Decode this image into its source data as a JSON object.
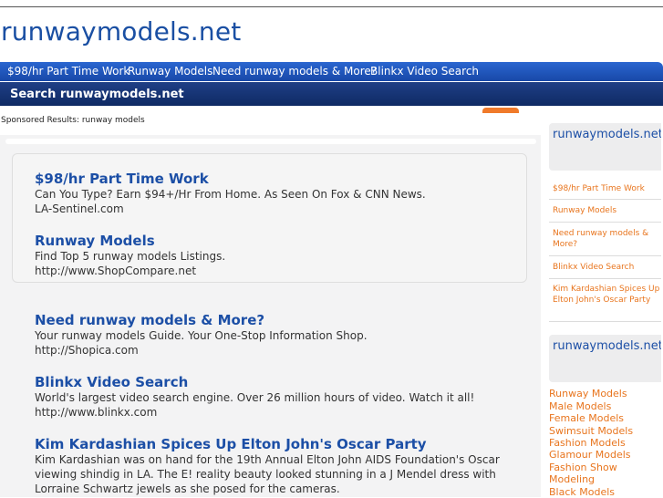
{
  "site_title": "runwaymodels.net",
  "nav": [
    "$98/hr Part Time Work",
    "Runway Models",
    "Need runway models & More?",
    "Blinkx Video Search"
  ],
  "search": {
    "label": "Search runwaymodels.net",
    "placeholder": "",
    "button_label": ""
  },
  "sponsored_text": "Sponsored Results: runway models",
  "ads": [
    {
      "title": "$98/hr Part Time Work",
      "desc": "Can You Type? Earn $94+/Hr From Home. As Seen On Fox & CNN News.",
      "url": "LA-Sentinel.com"
    },
    {
      "title": "Runway Models",
      "desc": "Find Top 5 runway models Listings.",
      "url": "http://www.ShopCompare.net"
    },
    {
      "title": "Need runway models & More?",
      "desc": "Your runway models Guide. Your One-Stop Information Shop.",
      "url": "http://Shopica.com"
    },
    {
      "title": "Blinkx Video Search",
      "desc": "World's largest video search engine. Over 26 million hours of video. Watch it all!",
      "url": "http://www.blinkx.com"
    },
    {
      "title": "Kim Kardashian Spices Up Elton John's Oscar Party",
      "desc": "Kim Kardashian was on hand for the 19th Annual Elton John AIDS Foundation's Oscar viewing shindig in LA. The E! reality beauty looked stunning in a J Mendel dress with Lorraine Schwartz jewels as she posed for the cameras.",
      "url": ""
    }
  ],
  "sidebar": {
    "links_heading": "runwaymodels.net Links",
    "links": [
      "$98/hr Part Time Work",
      "Runway Models",
      "Need runway models & More?",
      "Blinkx Video Search",
      "Kim Kardashian Spices Up Elton John's Oscar Party"
    ],
    "categories_heading": "runwaymodels.net Categories",
    "categories": [
      "Runway Models",
      "Male Models",
      "Female Models",
      "Swimsuit Models",
      "Fashion Models",
      "Glamour Models",
      "Fashion Show",
      "Modeling",
      "Black Models"
    ]
  },
  "colors": {
    "nav_blue": "#1848a8",
    "link_blue": "#1c4fa6",
    "accent_orange": "#e8751e"
  }
}
